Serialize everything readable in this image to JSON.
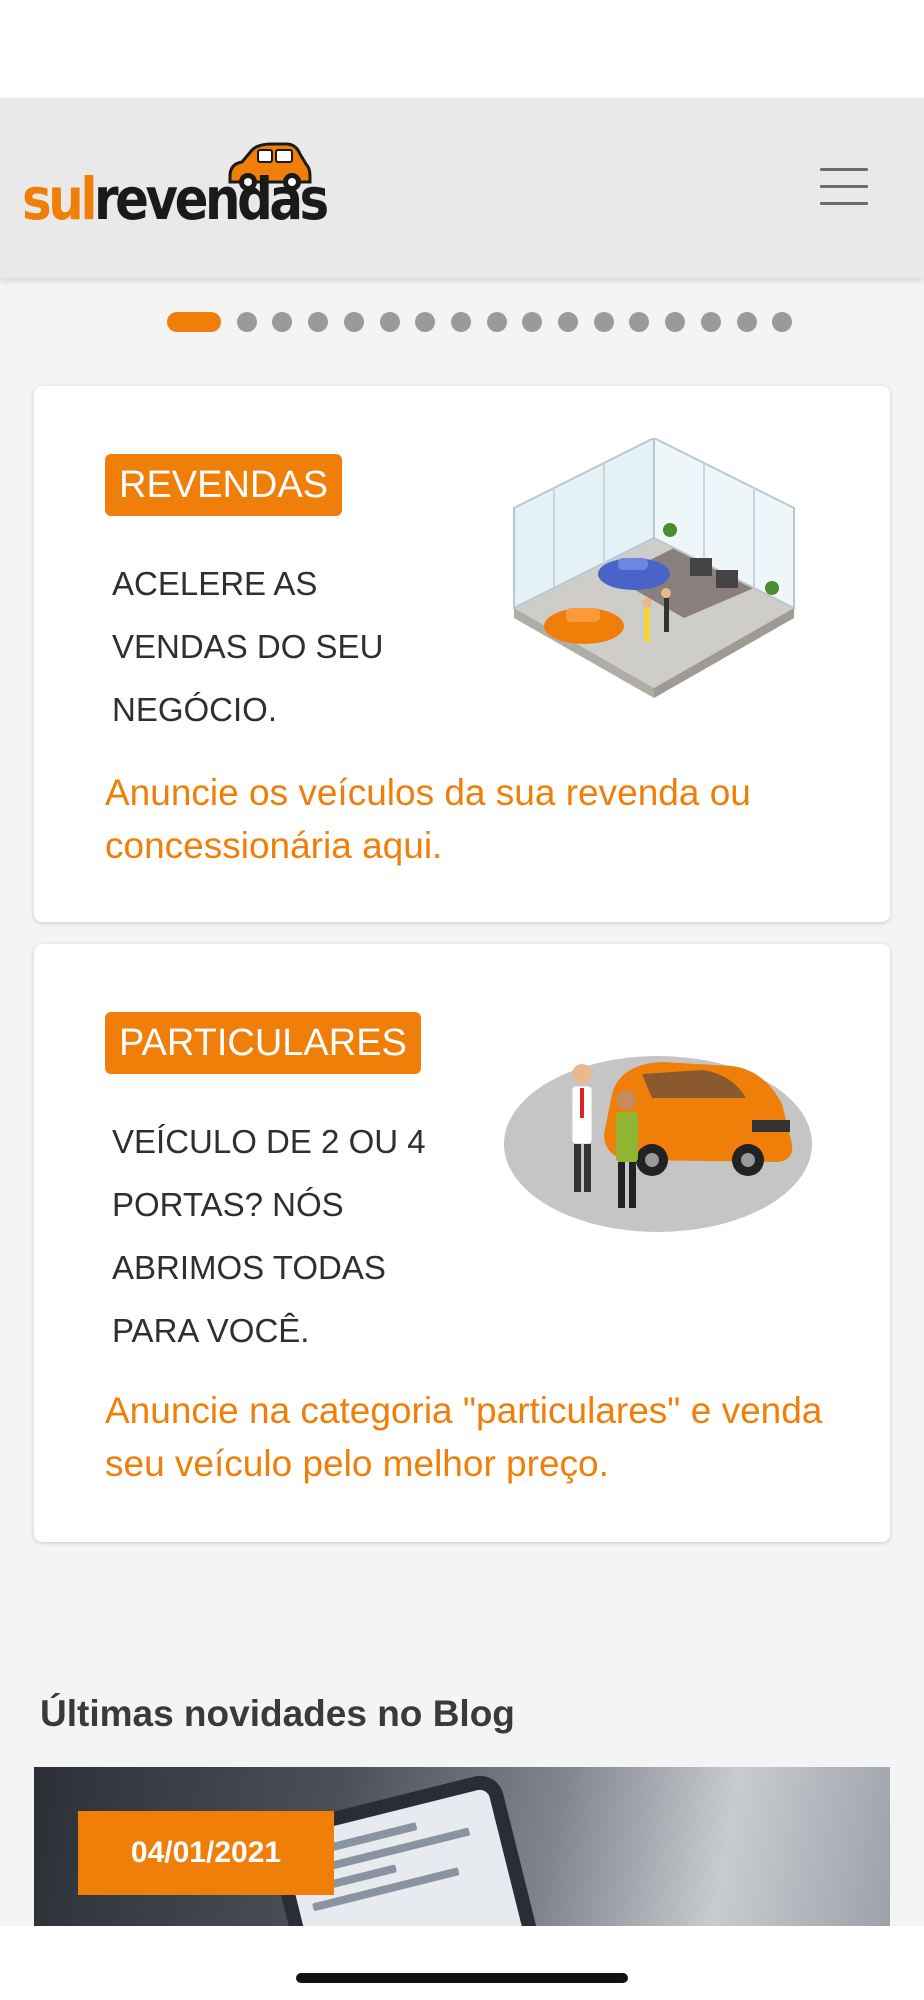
{
  "header": {
    "logo": {
      "part1": "sul",
      "part2": "revendas"
    },
    "menu_icon": "hamburger-icon"
  },
  "carousel": {
    "total_dots": 17,
    "active_index": 0
  },
  "cards": [
    {
      "badge": "REVENDAS",
      "text": "ACELERE AS VENDAS DO SEU NEGÓCIO.",
      "cta": "Anuncie os veículos da sua revenda ou concessionária aqui.",
      "image_icon": "car-showroom-illustration"
    },
    {
      "badge": "PARTICULARES",
      "text": "VEÍCULO DE 2 OU 4 PORTAS? NÓS ABRIMOS TODAS PARA VOCÊ.",
      "cta": "Anuncie na categoria \"particulares\" e venda seu veículo pelo melhor preço.",
      "image_icon": "car-handshake-illustration"
    }
  ],
  "blog": {
    "heading": "Últimas novidades no Blog",
    "posts": [
      {
        "date": "04/01/2021"
      }
    ]
  },
  "colors": {
    "accent": "#f07f0a",
    "navbar_bg": "#e9e9e9",
    "page_bg": "#f4f4f4"
  }
}
